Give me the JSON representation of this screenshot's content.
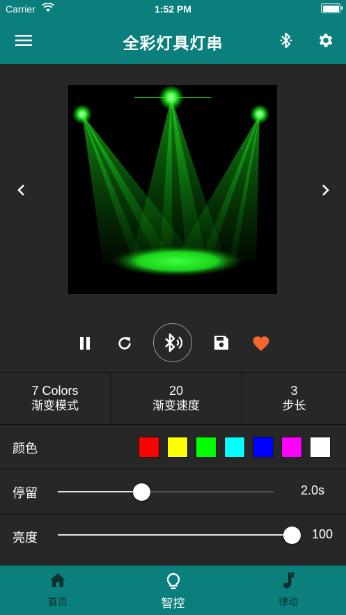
{
  "status": {
    "carrier": "Carrier",
    "time": "1:52 PM"
  },
  "header": {
    "title": "全彩灯具灯串"
  },
  "controls": {
    "active_color": "#f5662f"
  },
  "params": [
    {
      "value": "7 Colors",
      "label": "渐变模式"
    },
    {
      "value": "20",
      "label": "渐变速度"
    },
    {
      "value": "3",
      "label": "步长"
    }
  ],
  "colors": {
    "label": "颜色",
    "swatches": [
      "#ff0000",
      "#ffff00",
      "#00ff00",
      "#00ffff",
      "#0000ff",
      "#ff00ff",
      "#ffffff"
    ]
  },
  "stay": {
    "label": "停留",
    "value": "2.0s",
    "level": 0.39
  },
  "brightness": {
    "label": "亮度",
    "value": "100",
    "level": 1.0
  },
  "tabs": [
    {
      "label": "首页",
      "icon": "home-icon"
    },
    {
      "label": "智控",
      "icon": "bulb-icon",
      "active": true
    },
    {
      "label": "律动",
      "icon": "music-note-icon"
    }
  ],
  "theme": {
    "primary": "#0a7f7c",
    "background": "#272727"
  }
}
